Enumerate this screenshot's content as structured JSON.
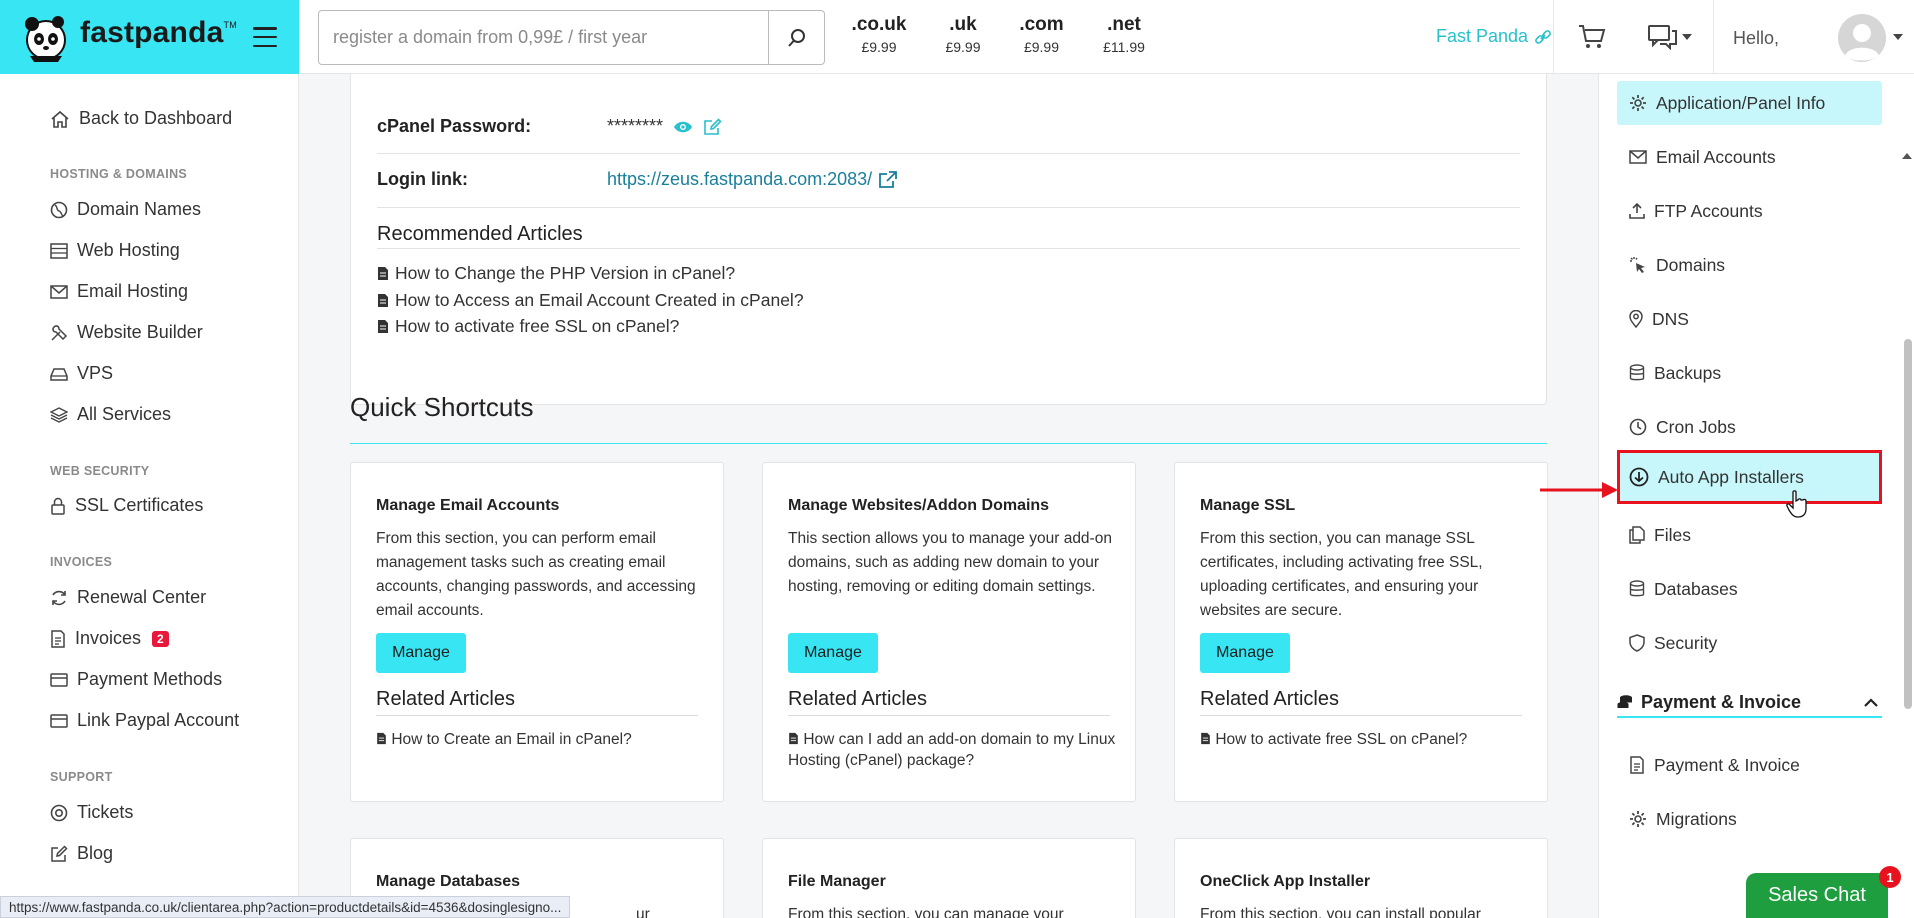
{
  "brand": {
    "name": "fastpanda",
    "tm": "TM"
  },
  "search": {
    "placeholder": "register a domain from 0,99£ / first year"
  },
  "tlds": [
    {
      "ext": ".co.uk",
      "price": "£9.99"
    },
    {
      "ext": ".uk",
      "price": "£9.99"
    },
    {
      "ext": ".com",
      "price": "£9.99"
    },
    {
      "ext": ".net",
      "price": "£11.99"
    }
  ],
  "header": {
    "account_link": "Fast Panda",
    "greeting": "Hello,"
  },
  "sidebar": {
    "back": "Back to Dashboard",
    "sections": {
      "hosting": "HOSTING & DOMAINS",
      "security": "WEB SECURITY",
      "invoices": "INVOICES",
      "support": "SUPPORT"
    },
    "items": {
      "domain_names": "Domain Names",
      "web_hosting": "Web Hosting",
      "email_hosting": "Email Hosting",
      "website_builder": "Website Builder",
      "vps": "VPS",
      "all_services": "All Services",
      "ssl": "SSL Certificates",
      "renewal": "Renewal Center",
      "invoices": "Invoices",
      "invoices_badge": "2",
      "payment_methods": "Payment Methods",
      "paypal": "Link Paypal Account",
      "tickets": "Tickets",
      "blog": "Blog"
    }
  },
  "details": {
    "password_label": "cPanel Password:",
    "password_value": "********",
    "login_label": "Login link:",
    "login_value": "https://zeus.fastpanda.com:2083/",
    "recommended_title": "Recommended Articles",
    "recommended": [
      "How to Change the PHP Version in cPanel?",
      "How to Access an Email Account Created in cPanel?",
      "How to activate free SSL on cPanel?"
    ]
  },
  "quick_shortcuts": {
    "title": "Quick Shortcuts",
    "related_title": "Related Articles",
    "manage_label": "Manage",
    "cards": [
      {
        "title": "Manage Email Accounts",
        "desc": "From this section, you can perform email management tasks such as creating email accounts, changing passwords, and accessing email accounts.",
        "related": "How to Create an Email in cPanel?"
      },
      {
        "title": "Manage Websites/Addon Domains",
        "desc": "This section allows you to manage your add-on domains, such as adding new domain to your hosting, removing or editing domain settings.",
        "related": "How can I add an add-on domain to my Linux Hosting (cPanel) package?"
      },
      {
        "title": "Manage SSL",
        "desc": "From this section, you can manage SSL certificates, including activating free SSL, uploading certificates, and ensuring your websites are secure.",
        "related": "How to activate free SSL on cPanel?"
      },
      {
        "title": "Manage Databases",
        "desc": "ur"
      },
      {
        "title": "File Manager",
        "desc": "From this section, you can manage your"
      },
      {
        "title": "OneClick App Installer",
        "desc": "From this section, you can install popular"
      }
    ]
  },
  "right_panel": {
    "items": [
      "Application/Panel Info",
      "Email Accounts",
      "FTP Accounts",
      "Domains",
      "DNS",
      "Backups",
      "Cron Jobs",
      "Auto App Installers",
      "Files",
      "Databases",
      "Security"
    ],
    "section_title": "Payment & Invoice",
    "section_items": [
      "Payment & Invoice",
      "Migrations"
    ]
  },
  "status_url": "https://www.fastpanda.co.uk/clientarea.php?action=productdetails&id=4536&dosinglesigno...",
  "sales_chat": {
    "label": "Sales Chat",
    "count": "1"
  },
  "colors": {
    "accent": "#37e6f2",
    "highlight_border": "#e8121f",
    "chat_green": "#1e9e3e"
  }
}
